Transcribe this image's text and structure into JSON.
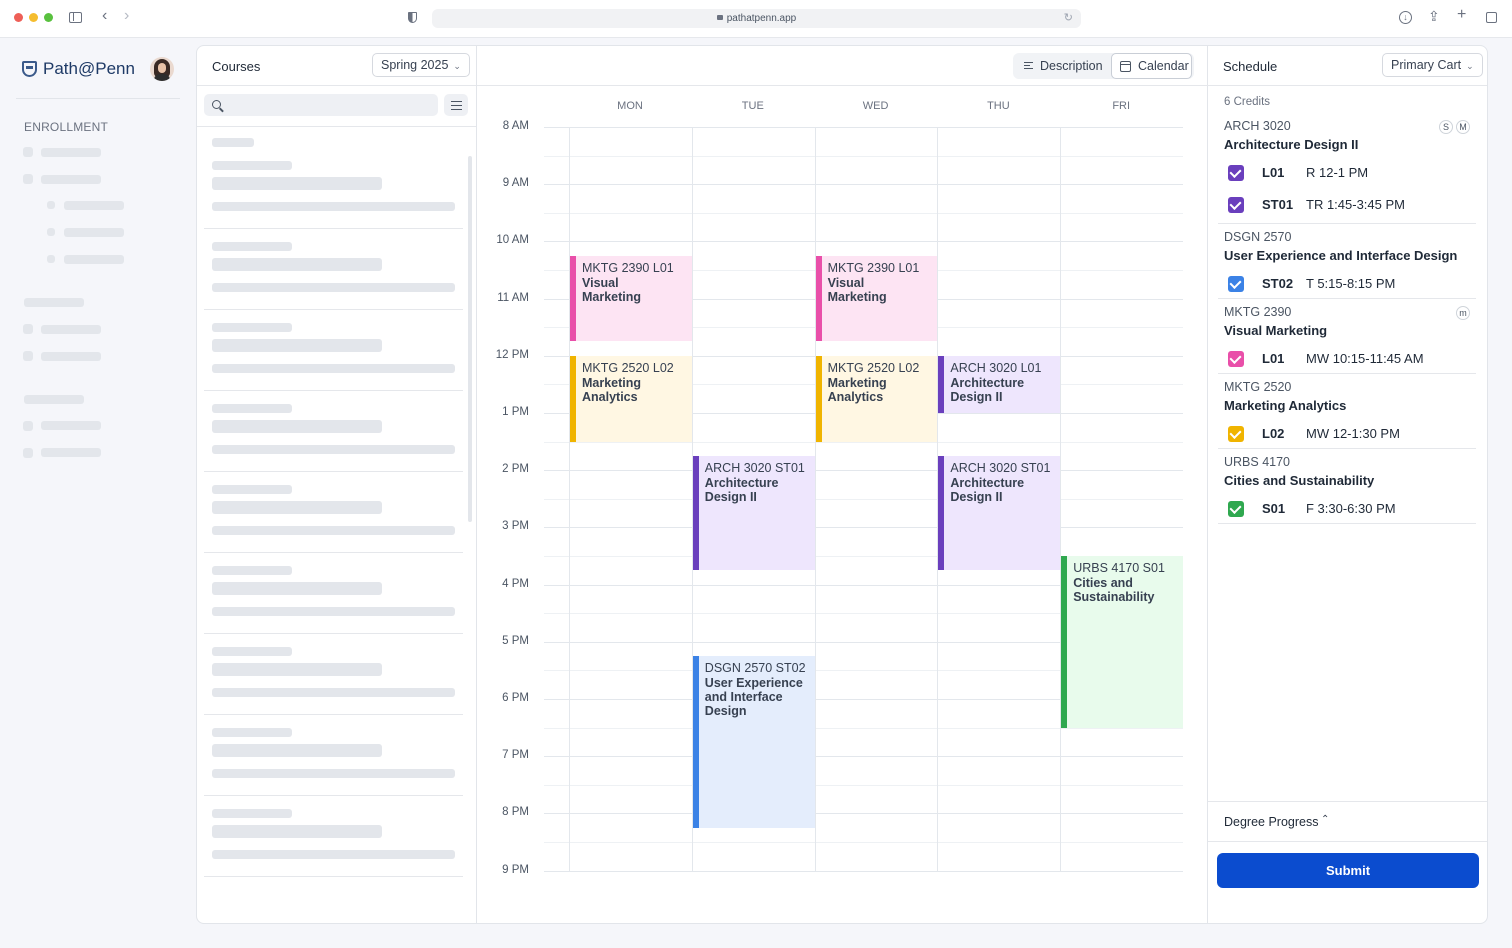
{
  "browser": {
    "url": "pathatpenn.app"
  },
  "brand": {
    "name": "Path@Penn"
  },
  "leftnav": {
    "section_label": "ENROLLMENT"
  },
  "courses": {
    "title": "Courses",
    "term_select": "Spring 2025",
    "search_placeholder": ""
  },
  "calendar": {
    "view_toggle": {
      "description_label": "Description",
      "calendar_label": "Calendar",
      "active": "Calendar"
    },
    "days": [
      "MON",
      "TUE",
      "WED",
      "THU",
      "FRI"
    ],
    "times": [
      "8 AM",
      "9 AM",
      "10 AM",
      "11 AM",
      "12 PM",
      "1 PM",
      "2 PM",
      "3 PM",
      "4 PM",
      "5 PM",
      "6 PM",
      "7 PM",
      "8 PM",
      "9 PM"
    ],
    "events": [
      {
        "code": "MKTG 2390 L01",
        "name": "Visual Marketing",
        "day": 0,
        "start": 10.25,
        "end": 11.75,
        "color": "#e94fa9",
        "bg": "#fde4f3"
      },
      {
        "code": "MKTG 2390 L01",
        "name": "Visual Marketing",
        "day": 2,
        "start": 10.25,
        "end": 11.75,
        "color": "#e94fa9",
        "bg": "#fde4f3"
      },
      {
        "code": "MKTG 2520 L02",
        "name": "Marketing Analytics",
        "day": 0,
        "start": 12,
        "end": 13.5,
        "color": "#f0b400",
        "bg": "#fff7e3"
      },
      {
        "code": "MKTG 2520 L02",
        "name": "Marketing Analytics",
        "day": 2,
        "start": 12,
        "end": 13.5,
        "color": "#f0b400",
        "bg": "#fff7e3"
      },
      {
        "code": "ARCH 3020 L01",
        "name": "Architecture Design II",
        "day": 3,
        "start": 12,
        "end": 13,
        "color": "#6a3fbd",
        "bg": "#eee6fd"
      },
      {
        "code": "ARCH 3020 ST01",
        "name": "Architecture Design II",
        "day": 1,
        "start": 13.75,
        "end": 15.75,
        "color": "#6a3fbd",
        "bg": "#eee6fd"
      },
      {
        "code": "ARCH 3020 ST01",
        "name": "Architecture Design II",
        "day": 3,
        "start": 13.75,
        "end": 15.75,
        "color": "#6a3fbd",
        "bg": "#eee6fd"
      },
      {
        "code": "URBS 4170 S01",
        "name": "Cities and Sustainability",
        "day": 4,
        "start": 15.5,
        "end": 18.5,
        "color": "#2fa84f",
        "bg": "#e8fbec"
      },
      {
        "code": "DSGN 2570 ST02",
        "name": "User Experience and Interface Design",
        "day": 1,
        "start": 17.25,
        "end": 20.25,
        "color": "#3b82e6",
        "bg": "#e4edfc"
      }
    ]
  },
  "schedule": {
    "title": "Schedule",
    "cart_select": "Primary Cart",
    "credits": "6 Credits",
    "groups": [
      {
        "code": "ARCH 3020",
        "name": "Architecture Design II",
        "badges": [
          "S",
          "M"
        ],
        "sections": [
          {
            "section": "L01",
            "time": "R 12-1 PM",
            "color": "#6a3fbd"
          },
          {
            "section": "ST01",
            "time": "TR 1:45-3:45 PM",
            "color": "#6a3fbd"
          }
        ]
      },
      {
        "code": "DSGN 2570",
        "name": "User Experience and Interface Design",
        "badges": [],
        "sections": [
          {
            "section": "ST02",
            "time": "T 5:15-8:15 PM",
            "color": "#3b82e6"
          }
        ]
      },
      {
        "code": "MKTG 2390",
        "name": "Visual Marketing",
        "badges": [
          "m"
        ],
        "sections": [
          {
            "section": "L01",
            "time": "MW 10:15-11:45 AM",
            "color": "#e94fa9"
          }
        ]
      },
      {
        "code": "MKTG 2520",
        "name": "Marketing Analytics",
        "badges": [],
        "sections": [
          {
            "section": "L02",
            "time": "MW 12-1:30 PM",
            "color": "#f0b400"
          }
        ]
      },
      {
        "code": "URBS 4170",
        "name": "Cities and Sustainability",
        "badges": [],
        "sections": [
          {
            "section": "S01",
            "time": "F 3:30-6:30 PM",
            "color": "#2fa84f"
          }
        ]
      }
    ],
    "degree_progress": "Degree Progress",
    "submit_label": "Submit"
  },
  "icons": {
    "sidebar_toggle": "sidebar-icon",
    "back": "chevron-left-icon",
    "forward": "chevron-right-icon",
    "privacy": "shield-half-icon",
    "lock": "lock-icon",
    "reload": "reload-icon",
    "download": "download-icon",
    "share": "share-icon",
    "new_tab": "plus-icon",
    "tabs": "tabs-icon",
    "search": "search-icon",
    "filter": "filter-icon",
    "description_view": "list-icon",
    "calendar_view": "calendar-icon"
  }
}
